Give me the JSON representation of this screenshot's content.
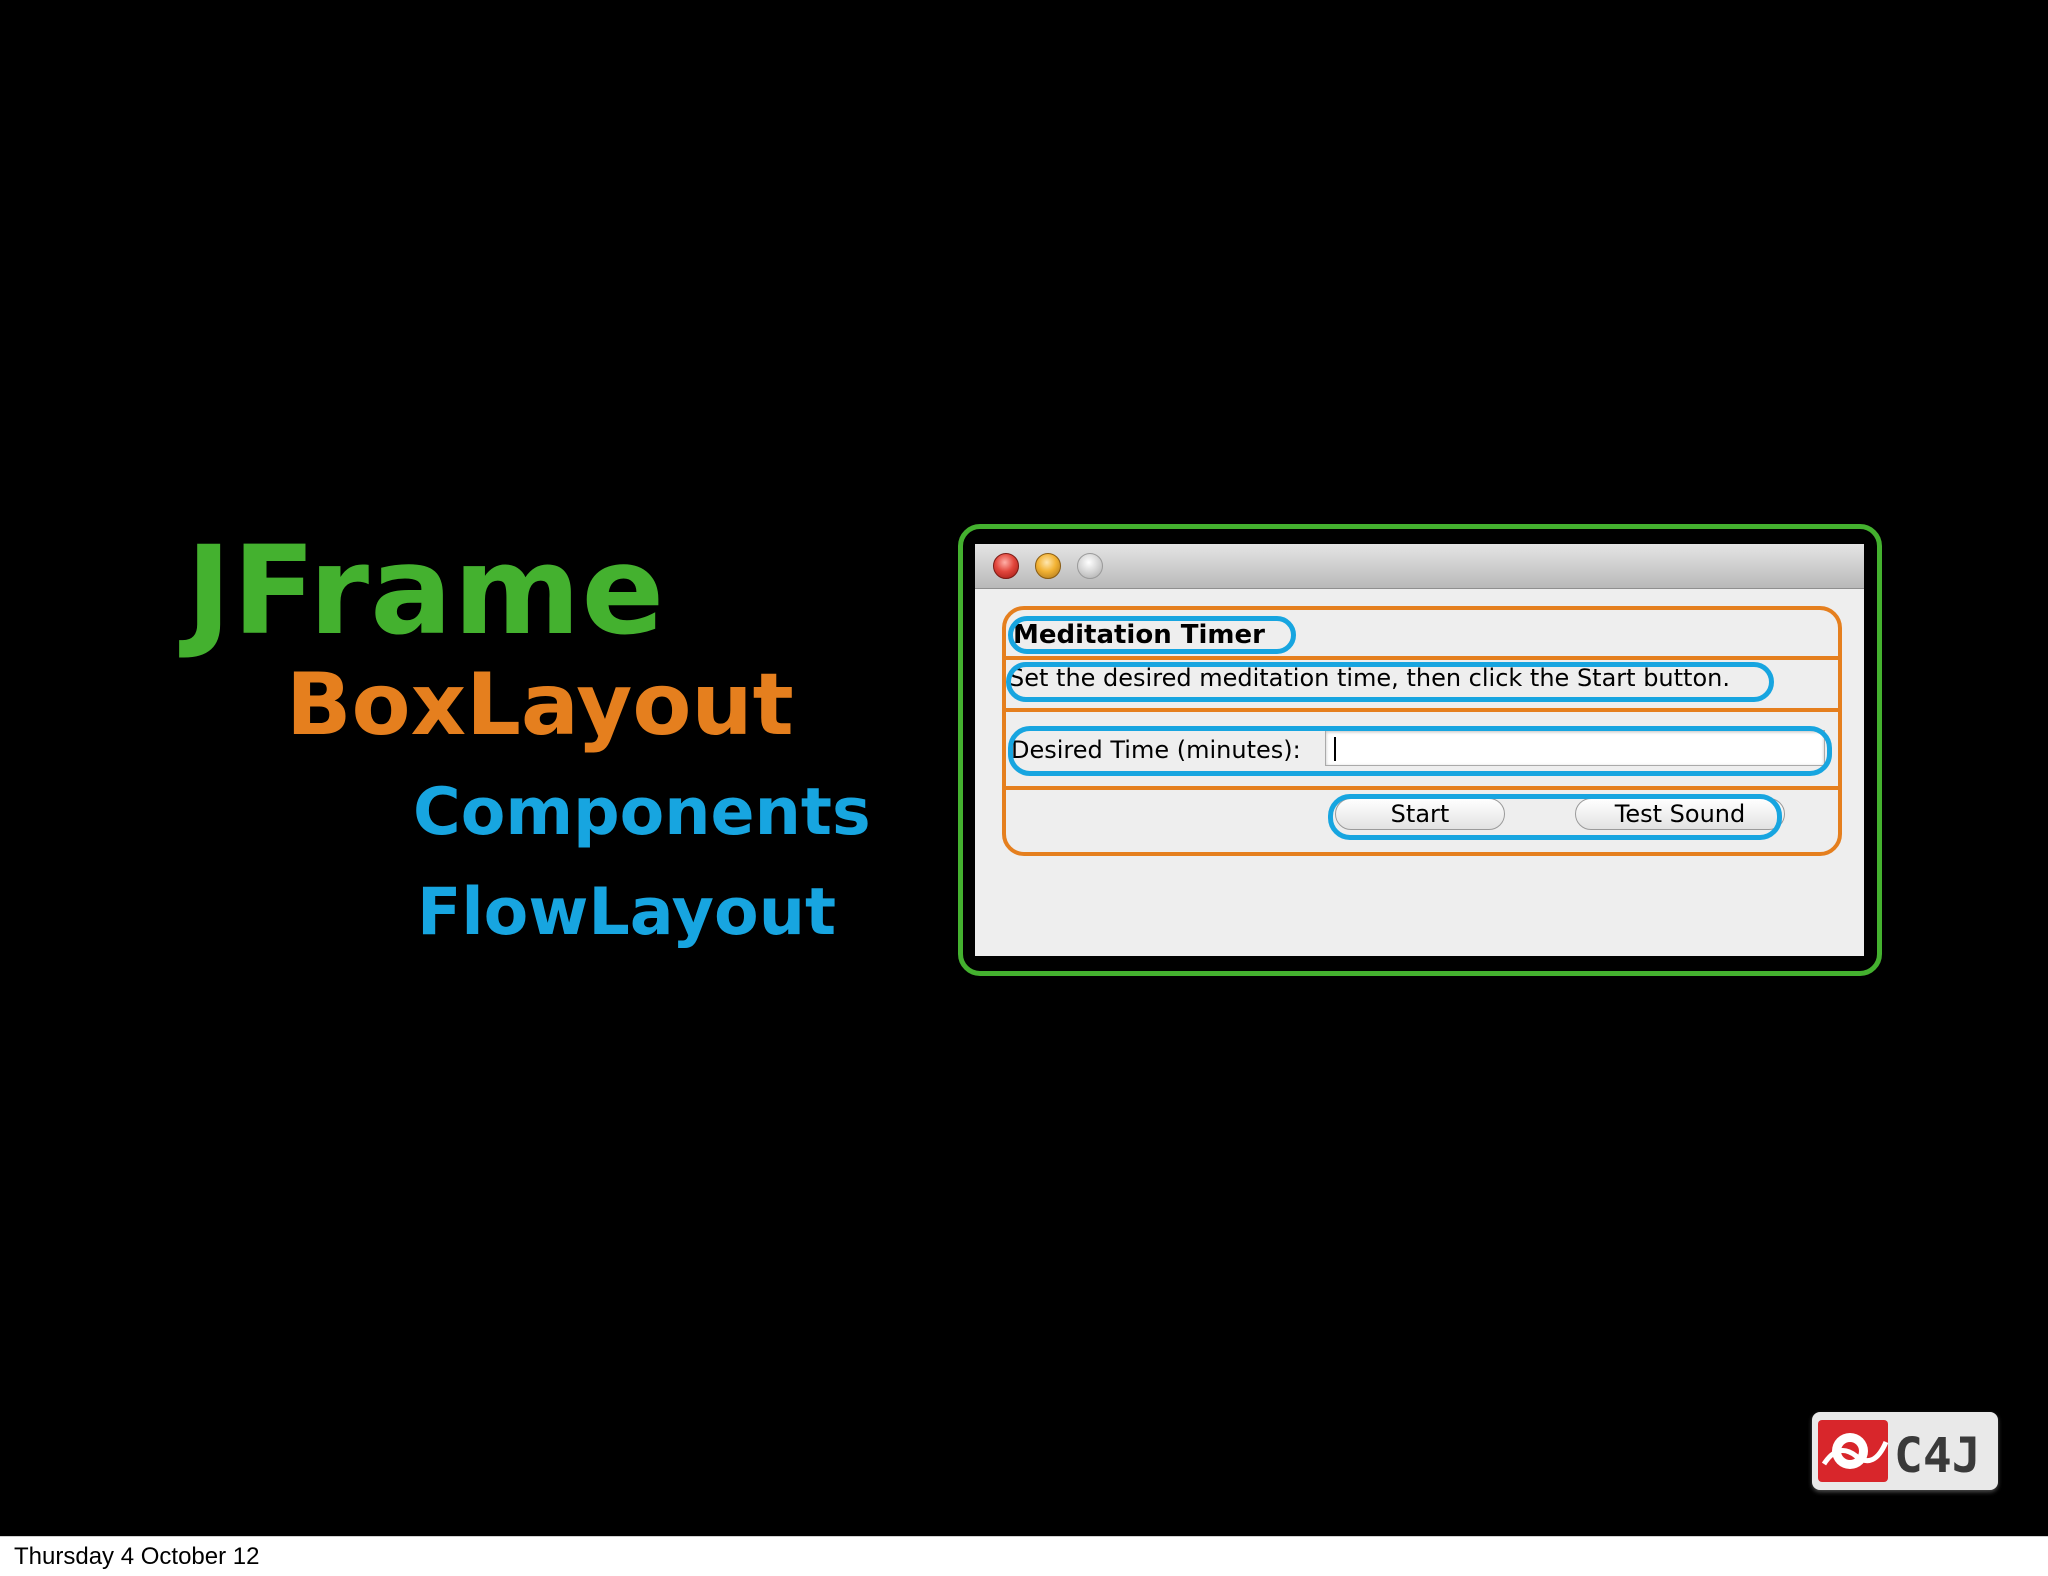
{
  "slide": {
    "labels": {
      "jframe": "JFrame",
      "boxlayout": "BoxLayout",
      "components": "Components",
      "flowlayout": "FlowLayout"
    },
    "colors": {
      "jframe": "#44b12f",
      "boxlayout": "#e57f1e",
      "components": "#17a5e0",
      "flowlayout": "#17a5e0",
      "background": "#000000"
    }
  },
  "window": {
    "title": "Meditation Timer",
    "instructions": "Set the desired meditation time, then click the Start button.",
    "time_label": "Desired Time (minutes):",
    "time_input_value": "",
    "start_button": "Start",
    "test_sound_button": "Test Sound",
    "traffic_lights": [
      "close-icon",
      "minimize-icon",
      "zoom-icon"
    ]
  },
  "logo": {
    "text": "C4J"
  },
  "footer": {
    "date": "Thursday 4 October 12"
  }
}
